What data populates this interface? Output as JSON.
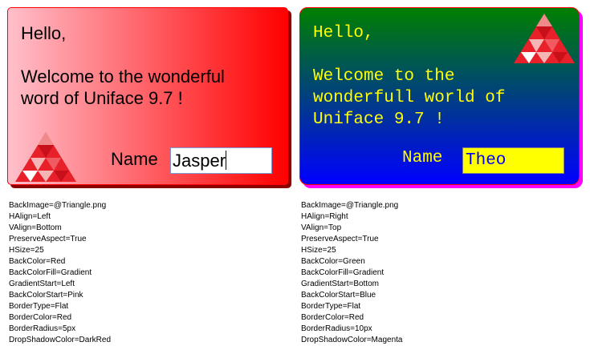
{
  "left_panel": {
    "greeting": "Hello,\n\nWelcome to the wonderful\nword of Uniface 9.7 !",
    "name_label": "Name",
    "name_value": "Jasper",
    "colors": {
      "back": "#ff0000",
      "gradient_start": "#ffc0cb",
      "border": "#ff0000",
      "shadow": "#8b0000"
    },
    "icon": "triangle-logo-icon",
    "properties": [
      "BackImage=@Triangle.png",
      "HAlign=Left",
      "VAlign=Bottom",
      "PreserveAspect=True",
      "HSize=25",
      "BackColor=Red",
      "BackColorFill=Gradient",
      "GradientStart=Left",
      "BackColorStart=Pink",
      "BorderType=Flat",
      "BorderColor=Red",
      "BorderRadius=5px",
      "DropShadowColor=DarkRed"
    ]
  },
  "right_panel": {
    "greeting": "Hello,\n\nWelcome to the\nwonderfull world of\nUniface 9.7 !",
    "name_label": "Name",
    "name_value": "Theo",
    "colors": {
      "back": "#008000",
      "gradient_start": "#0000ff",
      "border": "#ff0000",
      "shadow": "#ff00ff",
      "text": "#ffff00"
    },
    "icon": "triangle-logo-icon",
    "properties": [
      "BackImage=@Triangle.png",
      "HAlign=Right",
      "VAlign=Top",
      "PreserveAspect=True",
      "HSize=25",
      "BackColor=Green",
      "BackColorFill=Gradient",
      "GradientStart=Bottom",
      "BackColorStart=Blue",
      "BorderType=Flat",
      "BorderColor=Red",
      "BorderRadius=10px",
      "DropShadowColor=Magenta"
    ]
  }
}
